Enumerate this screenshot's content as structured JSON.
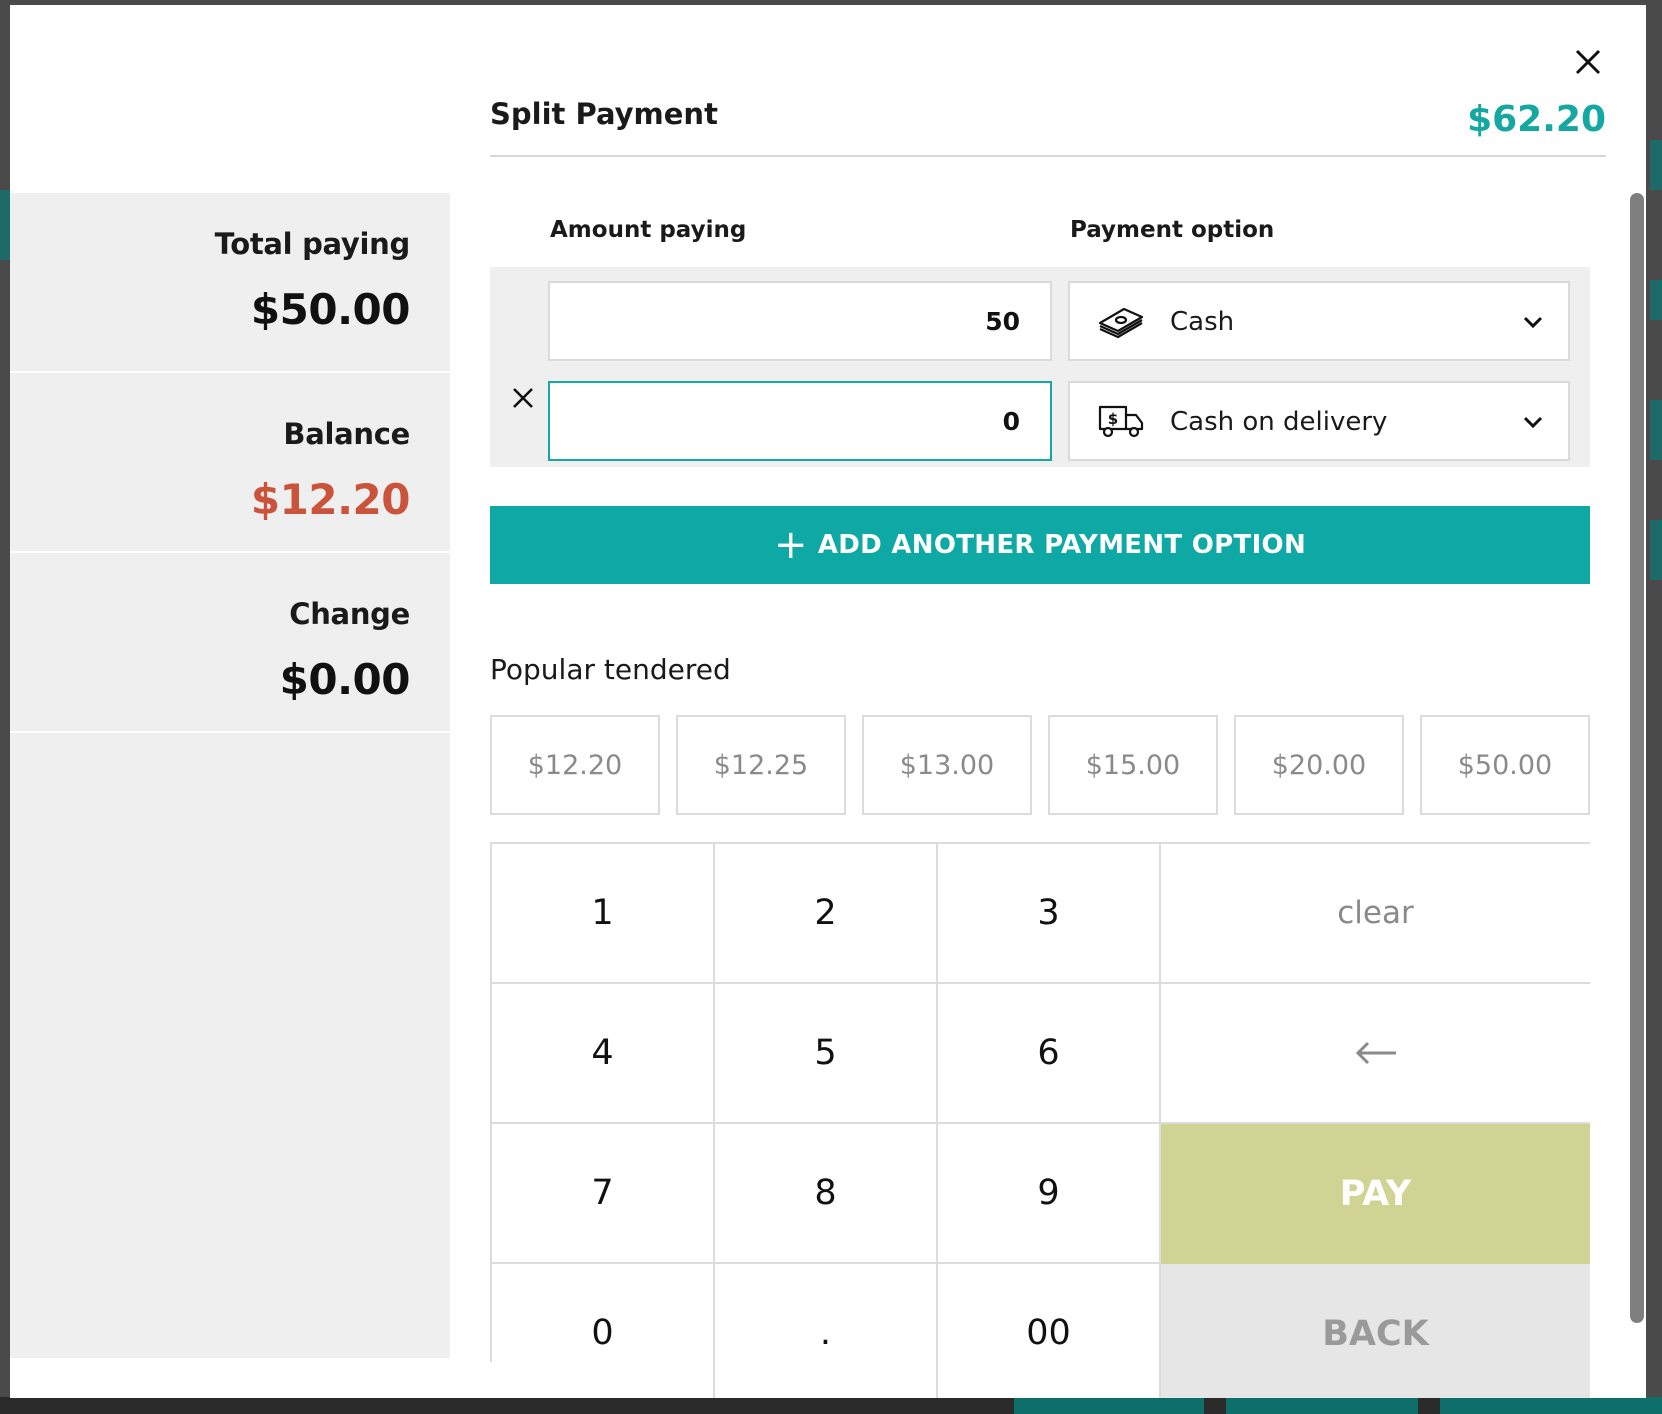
{
  "dialog": {
    "title": "Split Payment",
    "total": "$62.20"
  },
  "summary": {
    "total_paying_label": "Total paying",
    "total_paying_value": "$50.00",
    "balance_label": "Balance",
    "balance_value": "$12.20",
    "change_label": "Change",
    "change_value": "$0.00"
  },
  "columns": {
    "amount_label": "Amount paying",
    "option_label": "Payment option"
  },
  "payment_rows": [
    {
      "amount": "50",
      "option": "Cash",
      "icon": "cash-icon",
      "removable": false
    },
    {
      "amount": "0",
      "option": "Cash on delivery",
      "icon": "delivery-truck-icon",
      "removable": true
    }
  ],
  "add_button_label": "ADD ANOTHER PAYMENT OPTION",
  "popular": {
    "label": "Popular tendered",
    "amounts": [
      "$12.20",
      "$12.25",
      "$13.00",
      "$15.00",
      "$20.00",
      "$50.00"
    ]
  },
  "keypad": {
    "digits": [
      "1",
      "2",
      "3",
      "4",
      "5",
      "6",
      "7",
      "8",
      "9",
      "0",
      ".",
      "00"
    ],
    "clear_label": "clear",
    "backspace_icon": "arrow-left-icon",
    "pay_label": "PAY",
    "back_label": "BACK"
  },
  "colors": {
    "accent": "#0ea9a5",
    "total_text": "#15a7a1",
    "balance_text": "#c9543b",
    "pay_button": "#cfd494",
    "panel_bg": "#efefef"
  }
}
